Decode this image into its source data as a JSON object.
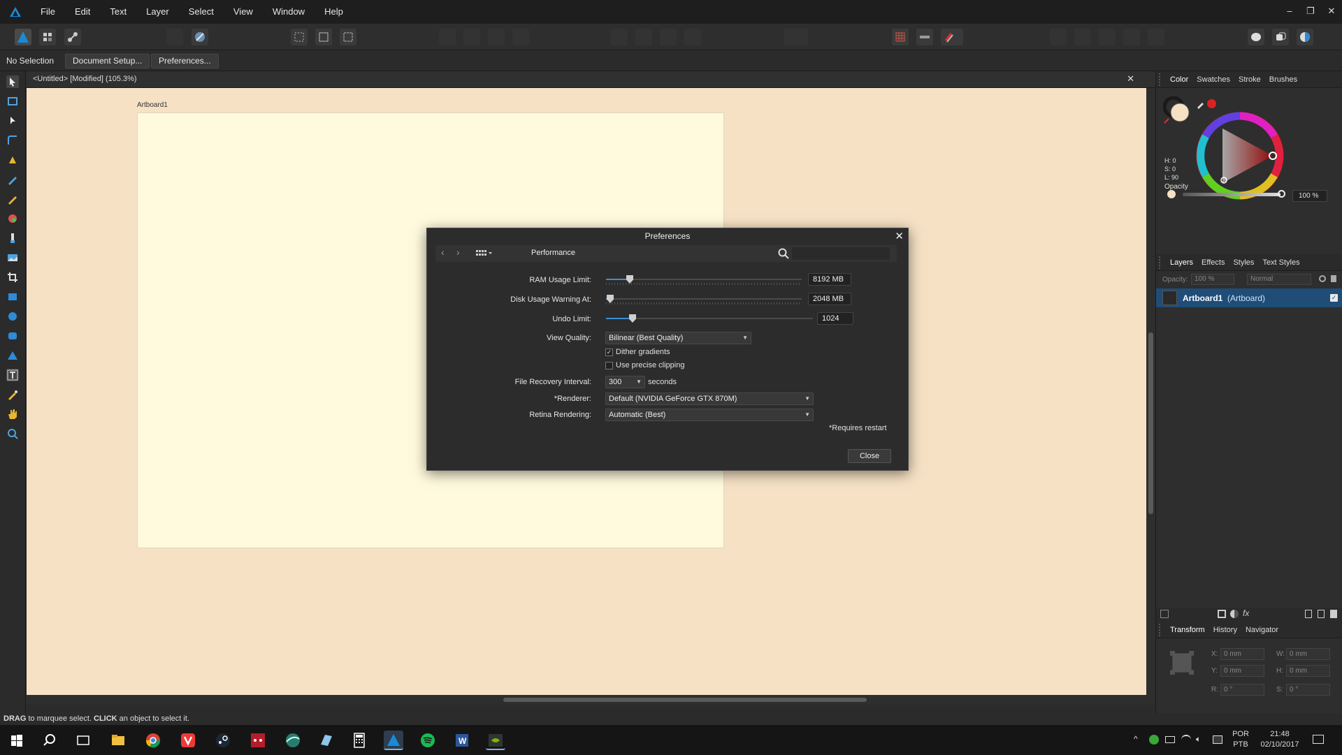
{
  "menu": {
    "items": [
      "File",
      "Edit",
      "Text",
      "Layer",
      "Select",
      "View",
      "Window",
      "Help"
    ],
    "window_controls": [
      "–",
      "❐",
      "✕"
    ]
  },
  "context": {
    "selection": "No Selection",
    "document_setup": "Document Setup...",
    "preferences": "Preferences..."
  },
  "document": {
    "tab_title": "<Untitled> [Modified] (105.3%)",
    "close": "✕",
    "artboard_label": "Artboard1"
  },
  "status": {
    "drag": "DRAG",
    "drag_text": " to marquee select. ",
    "click": "CLICK",
    "click_text": " an object to select it."
  },
  "color_panel": {
    "tabs": [
      "Color",
      "Swatches",
      "Stroke",
      "Brushes"
    ],
    "h": "H: 0",
    "s": "S: 0",
    "l": "L: 90",
    "opacity_label": "Opacity",
    "opacity_value": "100 %"
  },
  "layers_panel": {
    "tabs": [
      "Layers",
      "Effects",
      "Styles",
      "Text Styles"
    ],
    "opacity_label": "Opacity:",
    "opacity_value": "100 %",
    "blend_mode": "Normal",
    "layer_name": "Artboard1",
    "layer_type": "(Artboard)"
  },
  "transform_panel": {
    "tabs": [
      "Transform",
      "History",
      "Navigator"
    ],
    "x_label": "X:",
    "x": "0 mm",
    "y_label": "Y:",
    "y": "0 mm",
    "w_label": "W:",
    "w": "0 mm",
    "h_label": "H:",
    "h": "0 mm",
    "r_label": "R:",
    "r": "0 °",
    "s_label": "S:",
    "s": "0 °"
  },
  "preferences": {
    "title": "Preferences",
    "close": "✕",
    "section": "Performance",
    "ram_label": "RAM Usage Limit:",
    "ram_value": "8192 MB",
    "ram_level": 0.12,
    "disk_label": "Disk Usage Warning At:",
    "disk_value": "2048 MB",
    "disk_level": 0.02,
    "undo_label": "Undo Limit:",
    "undo_value": "1024",
    "undo_level": 0.13,
    "view_quality_label": "View Quality:",
    "view_quality": "Bilinear (Best Quality)",
    "dither_label": "Dither gradients",
    "dither_checked": true,
    "clipping_label": "Use precise clipping",
    "clipping_checked": false,
    "recovery_label": "File Recovery Interval:",
    "recovery_value": "300",
    "recovery_unit": "seconds",
    "renderer_label": "*Renderer:",
    "renderer_value": "Default (NVIDIA GeForce GTX 870M)",
    "retina_label": "Retina Rendering:",
    "retina_value": "Automatic (Best)",
    "restart_note": "*Requires restart",
    "close_button": "Close"
  },
  "taskbar": {
    "lang1": "POR",
    "lang2": "PTB",
    "time": "21:48",
    "date": "02/10/2017"
  },
  "colors": {
    "accent": "#3d8fd4",
    "canvas": "#f6e1c4",
    "artboard": "#fffadd",
    "layer_selected": "#1f4d78"
  }
}
